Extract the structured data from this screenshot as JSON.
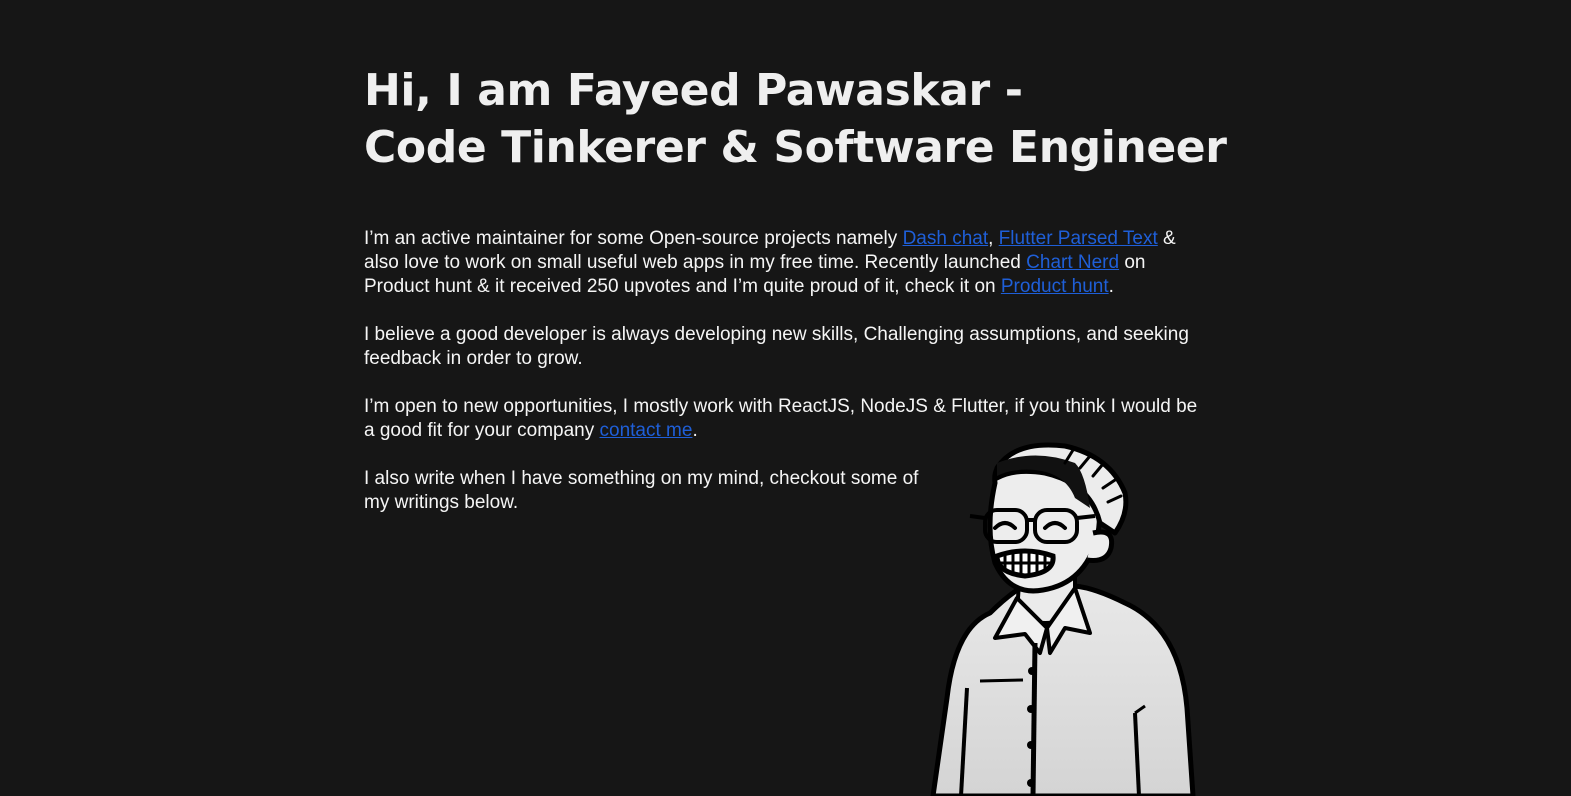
{
  "heading": {
    "line1": "Hi, I am Fayeed Pawaskar -",
    "line2": "Code Tinkerer & Software Engineer"
  },
  "bio": {
    "p1": {
      "t1": "I’m an active maintainer for some Open-source projects namely ",
      "link1": "Dash chat",
      "t2": ", ",
      "link2": "Flutter Parsed Text",
      "t3": " & also love to work on small useful web apps in my free time. Recently launched ",
      "link3": "Chart Nerd",
      "t4": " on Product hunt & it received 250 upvotes and I’m quite proud of it, check it on ",
      "link4": "Product hunt",
      "t5": "."
    },
    "p2": "I believe a good developer is always developing new skills, Challenging assumptions, and seeking feedback in order to grow.",
    "p3": {
      "t1": "I’m open to new opportunities, I mostly work with ReactJS, NodeJS & Flutter, if you think I would be a good fit for your company ",
      "link": "contact me",
      "t2": "."
    },
    "p4": "I also write when I have something on my mind, checkout some of my writings below."
  },
  "colors": {
    "background": "#161616",
    "text": "#f2f2f2",
    "link": "#1f5fd8"
  },
  "illustration": {
    "icon": "cartoon-avatar-illustration"
  }
}
